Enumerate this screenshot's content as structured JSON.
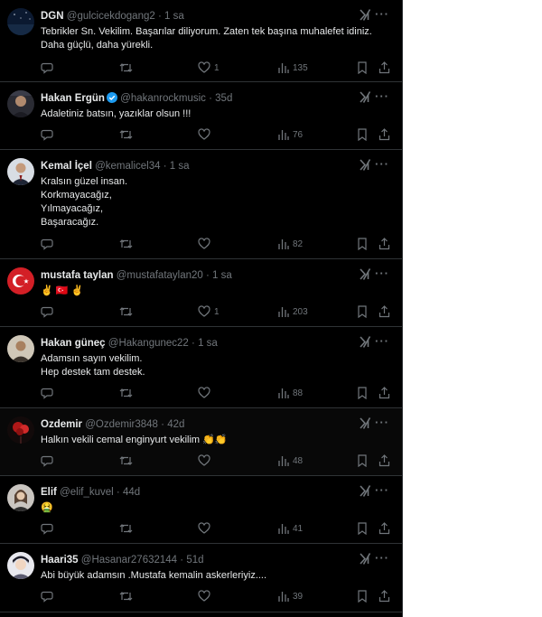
{
  "colors": {
    "background": "#000000",
    "text": "#e7e9ea",
    "muted": "#71767b",
    "border": "#2f3336",
    "verified": "#1d9bf0"
  },
  "tweets": [
    {
      "name": "DGN",
      "handle": "@gulcicekdogang2",
      "sep": "·",
      "time": "1 sa",
      "verified": false,
      "text": "Tebrikler Sn. Vekilim. Başarılar diliyorum. Zaten tek başına muhalefet idiniz. Daha güçlü, daha yürekli.",
      "likes": "1",
      "views": "135",
      "avatar": "dark-night-icon"
    },
    {
      "name": "Hakan Ergün",
      "handle": "@hakanrockmusic",
      "sep": "·",
      "time": "35d",
      "verified": true,
      "text": "Adaletiniz batsın, yazıklar olsun !!!",
      "likes": "",
      "views": "76",
      "avatar": "portrait-icon"
    },
    {
      "name": "Kemal İçel",
      "handle": "@kemalicel34",
      "sep": "·",
      "time": "1 sa",
      "verified": false,
      "text": "Kralsın güzel insan.\nKorkmayacağız,\nYılmayacağız,\nBaşaracağız.",
      "likes": "",
      "views": "82",
      "avatar": "man-in-suit-icon"
    },
    {
      "name": "mustafa taylan",
      "handle": "@mustafataylan20",
      "sep": "·",
      "time": "1 sa",
      "verified": false,
      "text": "✌️ 🇹🇷 ✌️",
      "likes": "1",
      "views": "203",
      "avatar": "red-flag-icon"
    },
    {
      "name": "Hakan güneç",
      "handle": "@Hakangunec22",
      "sep": "·",
      "time": "1 sa",
      "verified": false,
      "text": "Adamsın sayın vekilim.\nHep destek tam destek.",
      "likes": "",
      "views": "88",
      "avatar": "man-portrait-icon"
    },
    {
      "name": "Ozdemir",
      "handle": "@Ozdemir3848",
      "sep": "·",
      "time": "42d",
      "verified": false,
      "text": "Halkın vekili cemal enginyurt vekilim 👏👏",
      "likes": "",
      "views": "48",
      "avatar": "red-tree-icon"
    },
    {
      "name": "Elif",
      "handle": "@elif_kuvel",
      "sep": "·",
      "time": "44d",
      "verified": false,
      "text": "🤮",
      "likes": "",
      "views": "41",
      "avatar": "woman-portrait-icon"
    },
    {
      "name": "Haari35",
      "handle": "@Hasanar27632144",
      "sep": "·",
      "time": "51d",
      "verified": false,
      "text": "Abi büyük adamsın .Mustafa kemalin askerleriyiz....",
      "likes": "",
      "views": "39",
      "avatar": "anime-portrait-icon"
    }
  ]
}
